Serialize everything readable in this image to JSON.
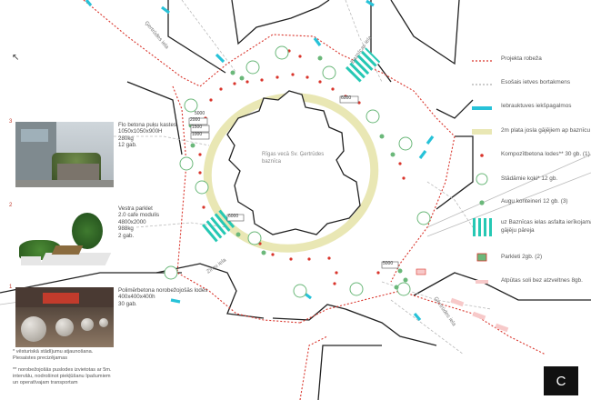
{
  "streets": {
    "gertrudes_top": "Ģertrūdes iela",
    "baznicas": "Baznīcas iela",
    "zirnu": "Zirņu iela",
    "gertrudes_bottom": "Ģertrūdes iela"
  },
  "church_label": "Rīgas vecā Sv. Ģertrūdes\nbaznīca",
  "dimensions": [
    "6000",
    "2000",
    "1500",
    "5000",
    "1000",
    "6000",
    "6000",
    "5000",
    "6000"
  ],
  "items": [
    {
      "number": "3",
      "text": "Flo betona puķu kastes\n1050x1050x900H\n280kg\n12 gab."
    },
    {
      "number": "2",
      "text": "Vestra parklet\n2.0 cafe modulis\n4800x2000\n988kg\n2 gab."
    },
    {
      "number": "1",
      "text": "Polimērbetona norobežojošās lodes\n400x400x400h\n30 gab."
    }
  ],
  "notes": [
    "* vēsturiskā stādījumu atjaunošana.\nPiesaistes precizējamas",
    "** norobežojošās puslodes izvietotas ar 5m.\nintervālu, nodrošinot piekļūšanu īpašumiem\nun operatīvajam transportam"
  ],
  "legend": [
    {
      "icon": "dotted-red-line",
      "label": "Projekta robeža"
    },
    {
      "icon": "dotted-grey-line",
      "label": "Esošais ietves bortakmens"
    },
    {
      "icon": "cyan-bar",
      "label": "Iebrauktuves iekšpagalmos"
    },
    {
      "icon": "yellow-band",
      "label": "2m plata josla gājējiem ap baznīcu"
    },
    {
      "icon": "red-dot",
      "label": "Kompozītbetona lodes**  30 gb. (1)"
    },
    {
      "icon": "tree-circle",
      "label": "Stādāmie koki* 12 gb."
    },
    {
      "icon": "green-dot",
      "label": "Augu konteineri 12 gb. (3)"
    },
    {
      "icon": "crosswalk",
      "label": "uz Baznīcas ielas asfalta ierīkojamā\ngājēju pāreja"
    },
    {
      "icon": "parklet",
      "label": "Parkleti 2gb. (2)"
    },
    {
      "icon": "pink-bar",
      "label": "Atpūtas soli bez atzveltnes 8gb."
    }
  ],
  "badge": "C",
  "colors": {
    "boundary": "#d9342b",
    "curb": "#9a9a9a",
    "entrance": "#27c2d8",
    "walk_band": "#e9e7b4",
    "tree": "#6bb87a",
    "crosswalk": "#26c8b4"
  }
}
